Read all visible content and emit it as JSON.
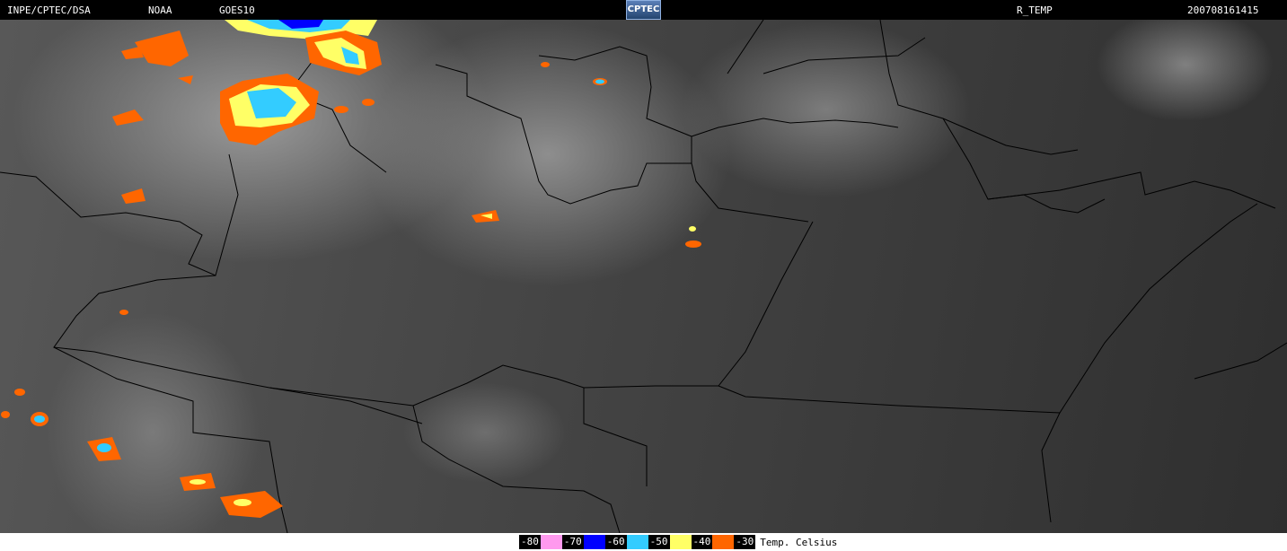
{
  "header": {
    "agency": "INPE/CPTEC/DSA",
    "source": "NOAA",
    "satellite": "GOES10",
    "product": "R_TEMP",
    "datetime": "200708161415",
    "logo_text": "CPTEC"
  },
  "legend": {
    "items": [
      {
        "label": "-80",
        "color": "#ff99ee"
      },
      {
        "label": "-70",
        "color": "#0000ff"
      },
      {
        "label": "-60",
        "color": "#33ccff"
      },
      {
        "label": "-50",
        "color": "#ffff66"
      },
      {
        "label": "-40",
        "color": "#ff6600"
      },
      {
        "label": "-30",
        "color": ""
      }
    ],
    "unit": "Temp. Celsius"
  },
  "colors": {
    "cloud_top_orange": "#ff6600",
    "cloud_top_yellow": "#ffff66",
    "cloud_top_cyan": "#33ccff",
    "cloud_top_blue": "#0000ff",
    "cloud_top_pink": "#ff99ee"
  }
}
